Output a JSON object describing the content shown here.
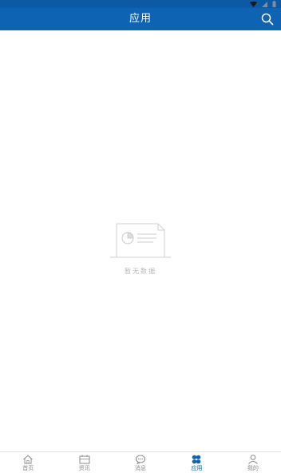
{
  "header": {
    "title": "应用",
    "search_icon": "search-icon"
  },
  "empty_state": {
    "text": "暂无数据",
    "illustration": "document-chart-icon"
  },
  "tabs": [
    {
      "label": "首页",
      "icon": "home-icon",
      "active": false
    },
    {
      "label": "资讯",
      "icon": "news-icon",
      "active": false
    },
    {
      "label": "消息",
      "icon": "message-icon",
      "active": false
    },
    {
      "label": "应用",
      "icon": "apps-icon",
      "active": true
    },
    {
      "label": "我的",
      "icon": "profile-icon",
      "active": false
    }
  ],
  "colors": {
    "primary": "#0e63b3",
    "inactive": "#8c8c8c",
    "empty_text": "#b8b8b8"
  }
}
